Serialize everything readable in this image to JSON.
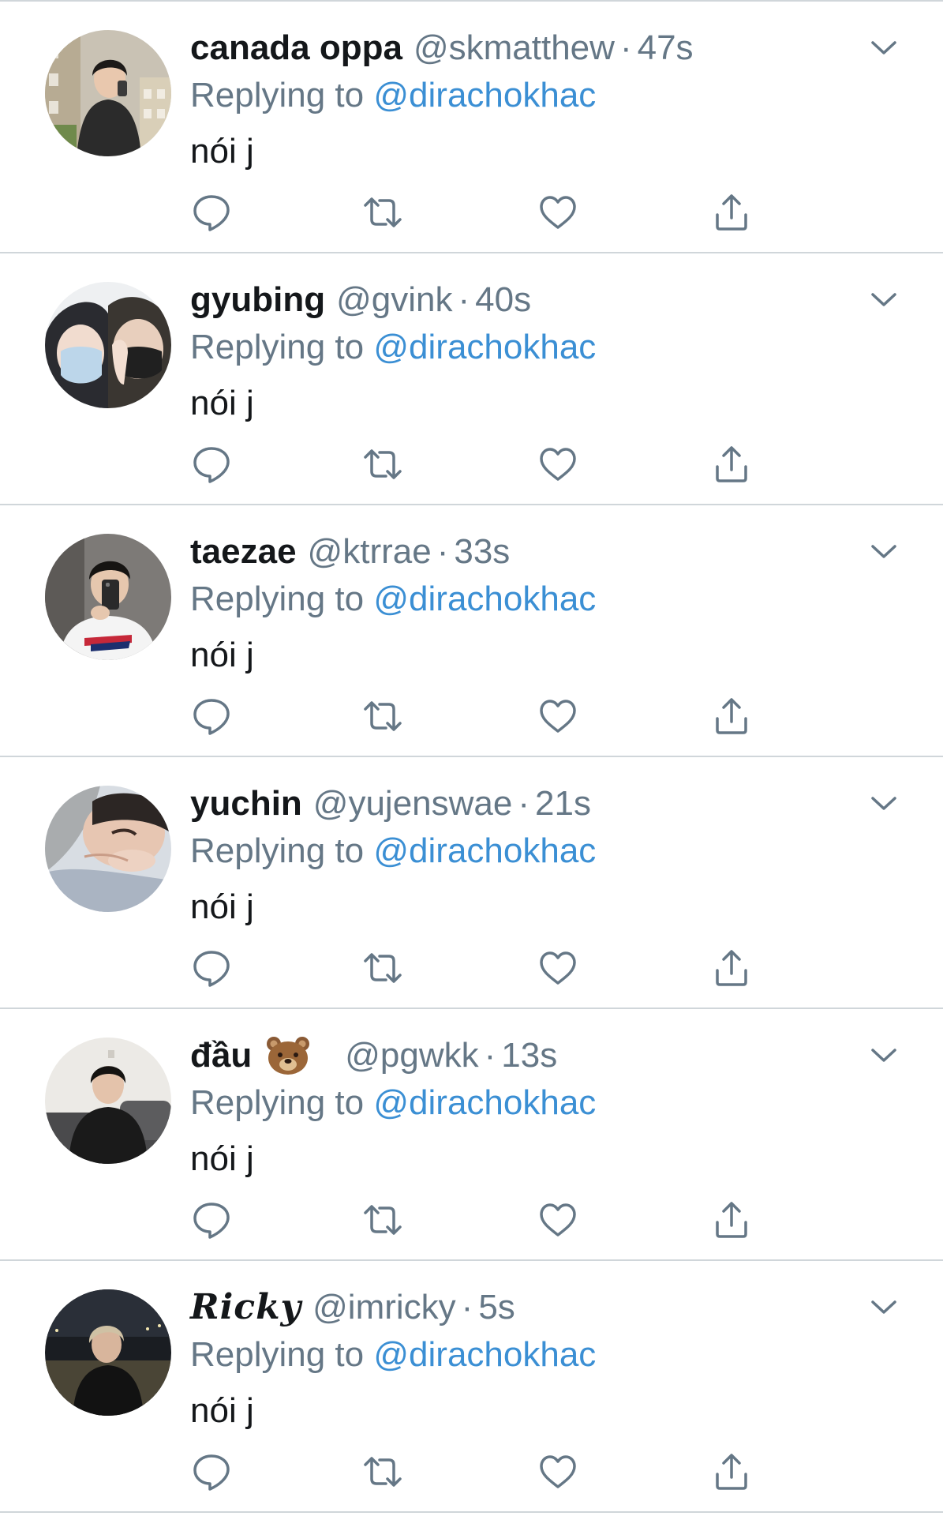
{
  "tweets": [
    {
      "display_name": "canada oppa",
      "handle": "@skmatthew",
      "separator": "·",
      "time": "47s",
      "replying_prefix": "Replying to",
      "replying_to": "@dirachokhac",
      "text": "nói j",
      "avatar": "avatar-photo"
    },
    {
      "display_name": "gyubing",
      "handle": "@gvink",
      "separator": "·",
      "time": "40s",
      "replying_prefix": "Replying to",
      "replying_to": "@dirachokhac",
      "text": "nói j",
      "avatar": "avatar-photo"
    },
    {
      "display_name": "taezae",
      "handle": "@ktrrae",
      "separator": "·",
      "time": "33s",
      "replying_prefix": "Replying to",
      "replying_to": "@dirachokhac",
      "text": "nói j",
      "avatar": "avatar-photo"
    },
    {
      "display_name": "yuchin",
      "handle": "@yujenswae",
      "separator": "·",
      "time": "21s",
      "replying_prefix": "Replying to",
      "replying_to": "@dirachokhac",
      "text": "nói j",
      "avatar": "avatar-photo"
    },
    {
      "display_name": "đầu",
      "name_emoji": "bear-face-icon",
      "handle": "@pgwkk",
      "separator": "·",
      "time": "13s",
      "replying_prefix": "Replying to",
      "replying_to": "@dirachokhac",
      "text": "nói j",
      "avatar": "avatar-photo"
    },
    {
      "display_name": "Ricky",
      "handle": "@imricky",
      "separator": "·",
      "time": "5s",
      "replying_prefix": "Replying to",
      "replying_to": "@dirachokhac",
      "text": "nói j",
      "avatar": "avatar-photo"
    }
  ],
  "icons": {
    "reply": "reply-icon",
    "retweet": "retweet-icon",
    "like": "heart-icon",
    "share": "share-icon",
    "more": "chevron-down-icon"
  },
  "colors": {
    "name": "#14171a",
    "secondary": "#657786",
    "link": "#3b8fd4",
    "divider": "#d0d6da",
    "icon": "#657786"
  }
}
